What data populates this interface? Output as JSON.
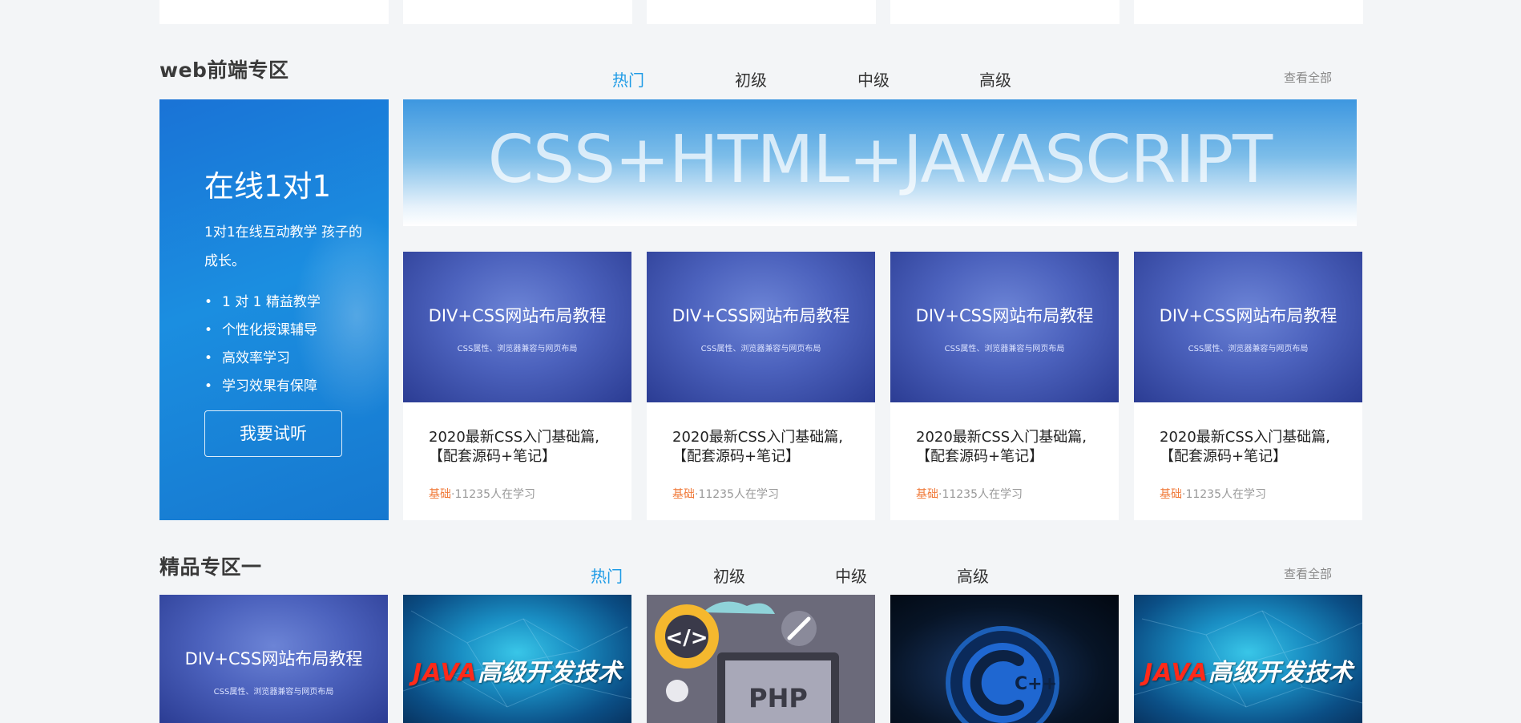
{
  "sections": {
    "web": {
      "title": "web前端专区",
      "tabs": [
        "热门",
        "初级",
        "中级",
        "高级"
      ],
      "view_all": "查看全部",
      "promo": {
        "title": "在线1对1",
        "desc": "1对1在线互动教学 孩子的成长。",
        "bullets": [
          "1 对 1 精益教学",
          "个性化授课辅导",
          "高效率学习",
          "学习效果有保障"
        ],
        "button": "我要试听"
      },
      "banner_text": "CSS+HTML+JAVASCRIPT",
      "courses": [
        {
          "thumb_title": "DIV+CSS网站布局教程",
          "thumb_sub": "CSS属性、浏览器兼容与网页布局",
          "title": "2020最新CSS入门基础篇,【配套源码+笔记】",
          "level": "基础",
          "learners": "·11235人在学习"
        },
        {
          "thumb_title": "DIV+CSS网站布局教程",
          "thumb_sub": "CSS属性、浏览器兼容与网页布局",
          "title": "2020最新CSS入门基础篇,【配套源码+笔记】",
          "level": "基础",
          "learners": "·11235人在学习"
        },
        {
          "thumb_title": "DIV+CSS网站布局教程",
          "thumb_sub": "CSS属性、浏览器兼容与网页布局",
          "title": "2020最新CSS入门基础篇,【配套源码+笔记】",
          "level": "基础",
          "learners": "·11235人在学习"
        },
        {
          "thumb_title": "DIV+CSS网站布局教程",
          "thumb_sub": "CSS属性、浏览器兼容与网页布局",
          "title": "2020最新CSS入门基础篇,【配套源码+笔记】",
          "level": "基础",
          "learners": "·11235人在学习"
        }
      ]
    },
    "premium": {
      "title": "精品专区一",
      "tabs": [
        "热门",
        "初级",
        "中级",
        "高级"
      ],
      "view_all": "查看全部",
      "thumbs": {
        "div_css": {
          "title": "DIV+CSS网站布局教程",
          "sub": "CSS属性、浏览器兼容与网页布局"
        },
        "java": {
          "latin": "JAVA",
          "cn": "高级开发技术"
        },
        "php": {
          "label": "PHP"
        },
        "cpp": {
          "label": "C++"
        }
      }
    }
  },
  "colors": {
    "page_bg": "#f3f5f7",
    "accent": "#1e9be6",
    "level": "#f07a3a"
  }
}
